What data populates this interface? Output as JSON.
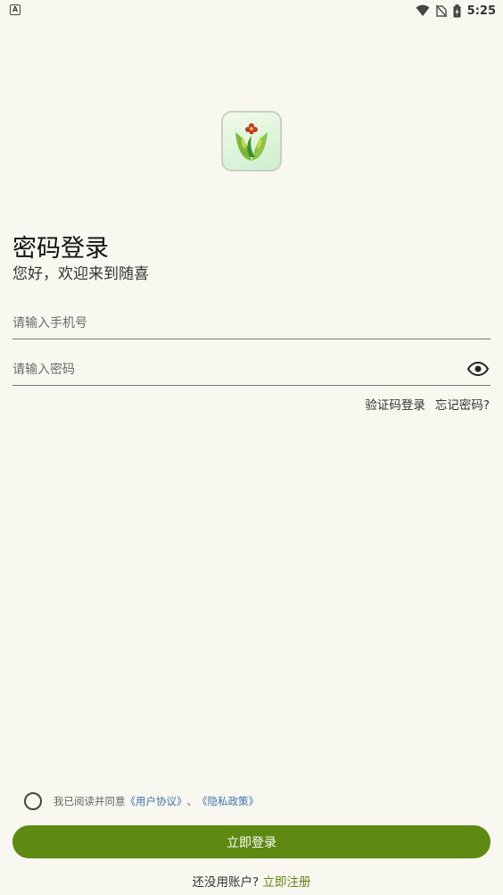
{
  "status_bar": {
    "time": "5:25",
    "notification_badge": "A"
  },
  "login": {
    "title": "密码登录",
    "subtitle": "您好，欢迎来到随喜",
    "phone_placeholder": "请输入手机号",
    "password_placeholder": "请输入密码",
    "code_login": "验证码登录",
    "forgot_password": "忘记密码?",
    "agree_prefix": "我已阅读并同意",
    "user_agreement": "《用户协议》",
    "separator": "、",
    "privacy_policy": "《隐私政策》",
    "login_button": "立即登录",
    "no_account": "还没用账户?",
    "register_link": "立即注册"
  },
  "colors": {
    "background": "#f9f8f0",
    "accent": "#5f8a12",
    "link": "#3c73b4"
  }
}
